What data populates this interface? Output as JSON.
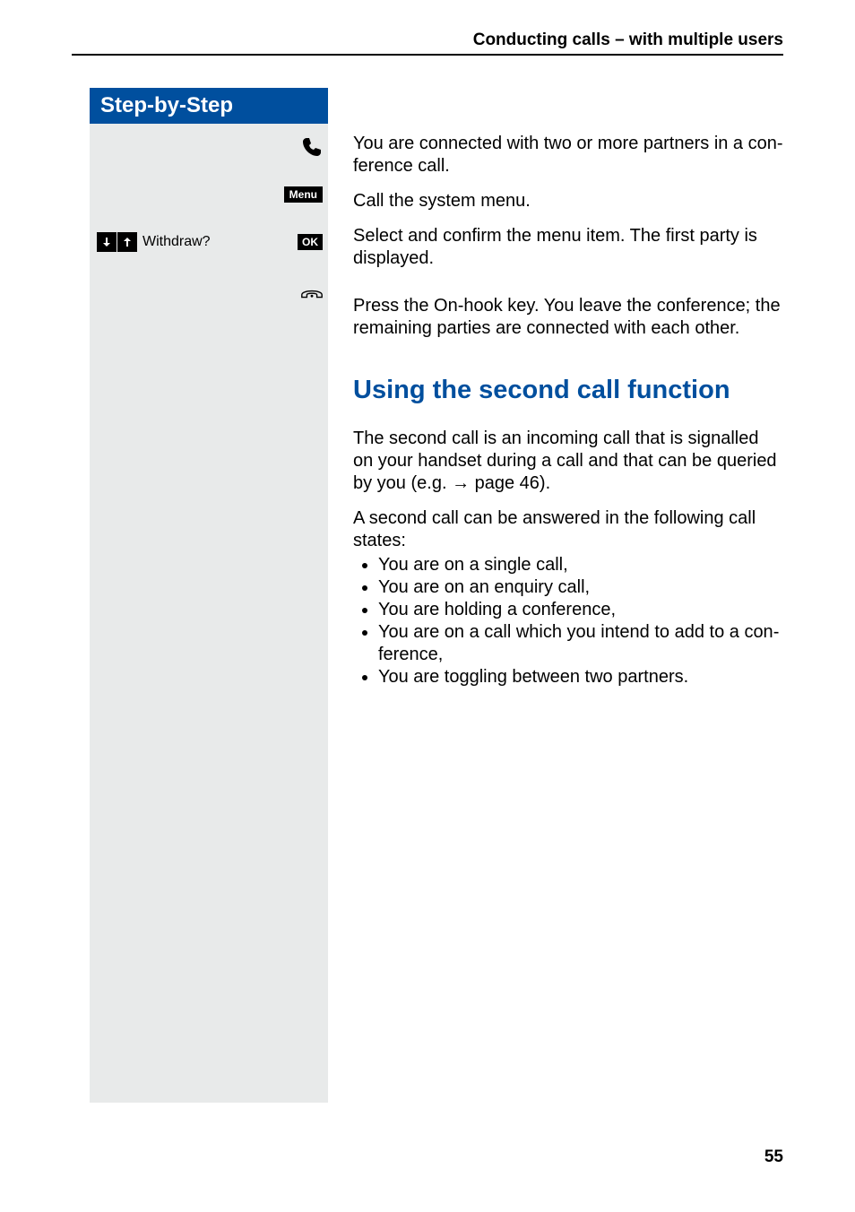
{
  "header": {
    "running_title": "Conducting calls – with multiple users"
  },
  "sidebar": {
    "banner": "Step-by-Step",
    "menu_button": "Menu",
    "withdraw_label": "Withdraw?",
    "ok_button": "OK"
  },
  "content": {
    "step1": "You are connected with two or more partners in a con­ference call.",
    "step2": "Call the system menu.",
    "step3": "Select and confirm the menu item. The first party is dis­played.",
    "step4": "Press the On-hook key. You leave the conference; the remaining parties are connected with each other.",
    "section_title": "Using the second call function",
    "para_intro_a": "The second call is an incoming call that is signalled on your handset during a call and that can be queried by you (e.g.  ",
    "para_intro_arrow": "→",
    "para_intro_b": " page 46).",
    "para_states_lead": "A second call can be answered in the following call states:",
    "states": [
      "You are on a single call,",
      "You are on an enquiry call,",
      "You are holding a conference,",
      "You are on a call which you intend to add to a con­ference,",
      "You are toggling between two partners."
    ]
  },
  "page_number": "55"
}
